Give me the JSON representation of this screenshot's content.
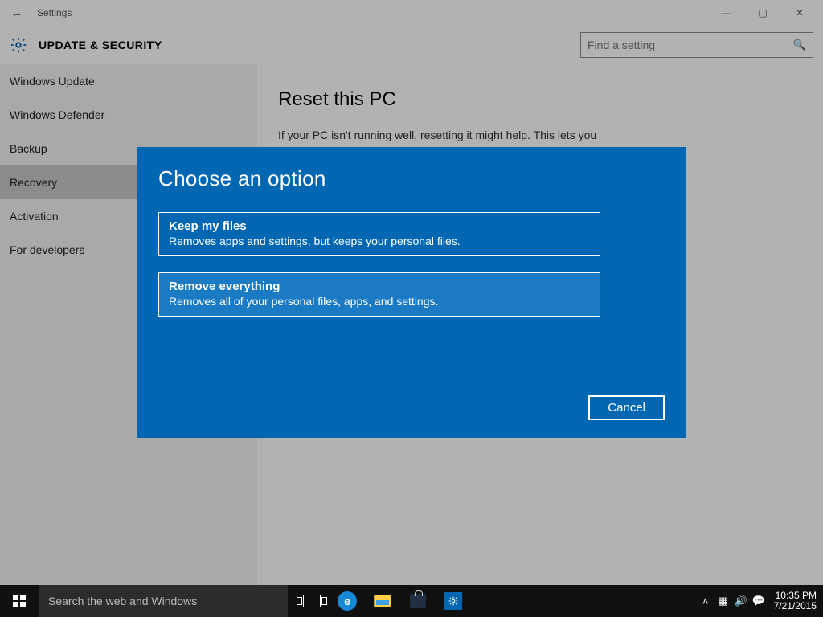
{
  "window": {
    "title": "Settings",
    "heading": "UPDATE & SECURITY"
  },
  "search": {
    "placeholder": "Find a setting"
  },
  "sidebar": {
    "items": [
      {
        "label": "Windows Update"
      },
      {
        "label": "Windows Defender"
      },
      {
        "label": "Backup"
      },
      {
        "label": "Recovery"
      },
      {
        "label": "Activation"
      },
      {
        "label": "For developers"
      }
    ]
  },
  "page": {
    "title": "Reset this PC",
    "desc": "If your PC isn't running well, resetting it might help. This lets you choose to keep your files or remove them, and then reinstalls"
  },
  "dialog": {
    "title": "Choose an option",
    "options": [
      {
        "title": "Keep my files",
        "desc": "Removes apps and settings, but keeps your personal files."
      },
      {
        "title": "Remove everything",
        "desc": "Removes all of your personal files, apps, and settings."
      }
    ],
    "cancel": "Cancel"
  },
  "taskbar": {
    "cortana_placeholder": "Search the web and Windows",
    "time": "10:35 PM",
    "date": "7/21/2015"
  }
}
